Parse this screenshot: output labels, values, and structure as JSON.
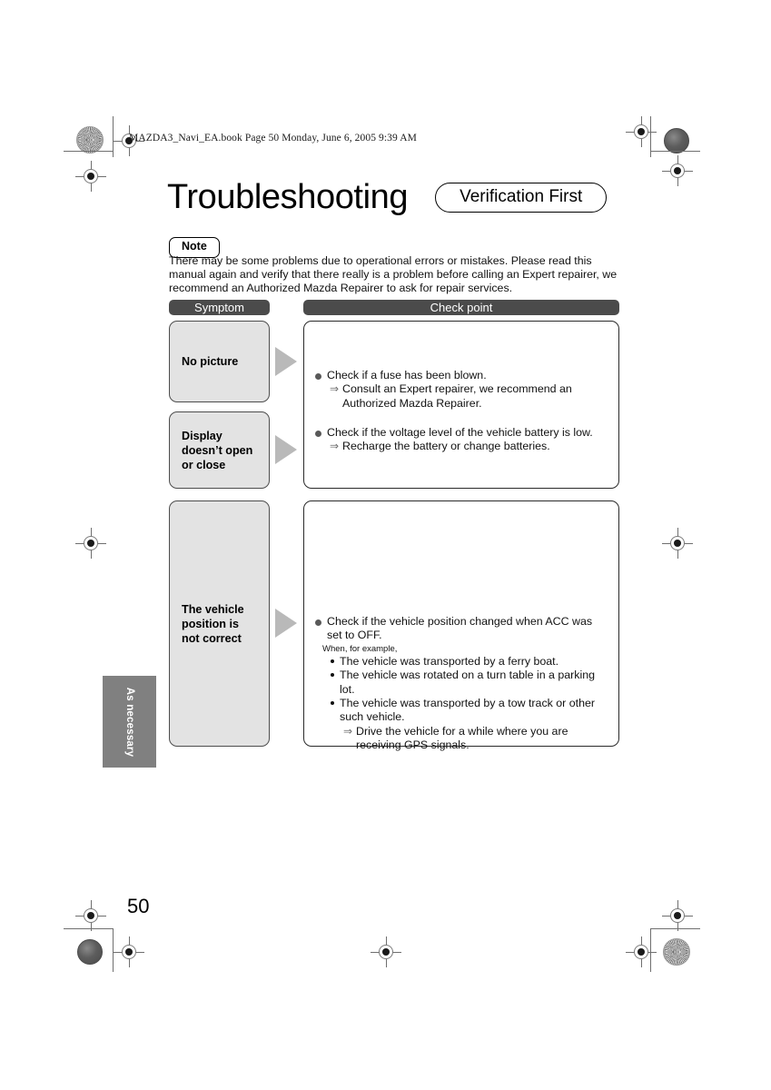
{
  "print_header": {
    "file_line": "MAZDA3_Navi_EA.book  Page 50  Monday, June 6, 2005  9:39 AM"
  },
  "header": {
    "title": "Troubleshooting",
    "pill_label": "Verification First"
  },
  "note": {
    "badge": "Note",
    "body": "There may be some problems due to operational errors or mistakes. Please read this manual again and verify that there really is a problem before calling an Expert repairer, we recommend an Authorized Mazda Repairer to ask for repair services."
  },
  "table": {
    "headers": {
      "symptom": "Symptom",
      "check_point": "Check point"
    },
    "symptoms": [
      {
        "label": "No picture"
      },
      {
        "label": "Display doesn’t open or close"
      },
      {
        "label": "The vehicle position is not correct"
      }
    ],
    "check_blocks": [
      {
        "groups": [
          {
            "bullet": "Check if a fuse has been blown.",
            "arrow": "Consult an Expert repairer, we recommend an Authorized Mazda Repairer."
          },
          {
            "bullet": "Check if the voltage level of the vehicle battery is low.",
            "arrow": "Recharge the battery or change batteries."
          }
        ]
      },
      {
        "groups": [
          {
            "bullet": "Check if the vehicle position changed when ACC was set to OFF.",
            "small_note": "When, for example,",
            "dashes": [
              "The vehicle was transported by a ferry boat.",
              "The vehicle was rotated on a turn table in a parking lot.",
              "The vehicle was transported by a tow track or other such vehicle."
            ],
            "arrow": "Drive the vehicle for a while where you are receiving GPS signals."
          }
        ]
      }
    ]
  },
  "side_tab": {
    "label": "As necessary"
  },
  "footer": {
    "page_number": "50"
  },
  "icons": {
    "bullet": "filled-disc-bullet",
    "sub_arrow": "⇨",
    "flow_arrow": "right-triangle-arrow"
  },
  "colors": {
    "header_bar": "#4b4b4b",
    "symptom_box": "#e3e3e3",
    "side_tab": "#808080",
    "arrow": "#b9b9b9"
  }
}
